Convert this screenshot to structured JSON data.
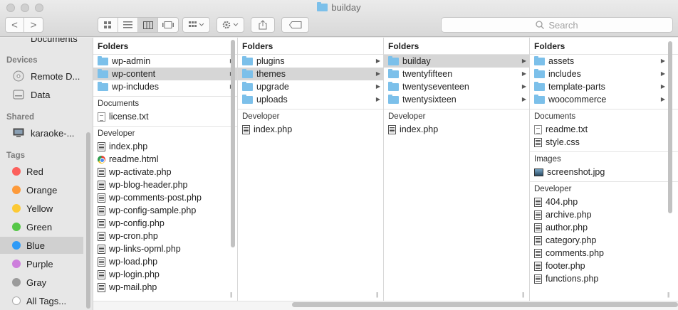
{
  "window": {
    "title": "builday"
  },
  "toolbar": {
    "back": "<",
    "forward": ">",
    "view_icons": [
      "icon-view",
      "list-view",
      "column-view",
      "gallery-view"
    ],
    "arrange": "arrange",
    "action": "action",
    "share": "share",
    "tags": "tags",
    "search_placeholder": "Search"
  },
  "sidebar": {
    "partial_top": "Documents",
    "devices_head": "Devices",
    "devices": [
      "Remote D...",
      "Data"
    ],
    "shared_head": "Shared",
    "shared": [
      "karaoke-..."
    ],
    "tags_head": "Tags",
    "tags": [
      {
        "label": "Red",
        "color": "#fc605c"
      },
      {
        "label": "Orange",
        "color": "#fd9a3a"
      },
      {
        "label": "Yellow",
        "color": "#fcc935"
      },
      {
        "label": "Green",
        "color": "#56c748"
      },
      {
        "label": "Blue",
        "color": "#2f9bf7"
      },
      {
        "label": "Purple",
        "color": "#cd7fdc"
      },
      {
        "label": "Gray",
        "color": "#9b9b9b"
      },
      {
        "label": "All Tags..."
      }
    ]
  },
  "col1": {
    "head": "Folders",
    "folders": [
      "wp-admin",
      "wp-content",
      "wp-includes"
    ],
    "docs_head": "Documents",
    "docs": [
      "license.txt"
    ],
    "dev_head": "Developer",
    "dev": [
      "index.php",
      "readme.html",
      "wp-activate.php",
      "wp-blog-header.php",
      "wp-comments-post.php",
      "wp-config-sample.php",
      "wp-config.php",
      "wp-cron.php",
      "wp-links-opml.php",
      "wp-load.php",
      "wp-login.php",
      "wp-mail.php"
    ]
  },
  "col2": {
    "head": "Folders",
    "folders": [
      "plugins",
      "themes",
      "upgrade",
      "uploads"
    ],
    "dev_head": "Developer",
    "dev": [
      "index.php"
    ]
  },
  "col3": {
    "head": "Folders",
    "folders": [
      "builday",
      "twentyfifteen",
      "twentyseventeen",
      "twentysixteen"
    ],
    "dev_head": "Developer",
    "dev": [
      "index.php"
    ]
  },
  "col4": {
    "head": "Folders",
    "folders": [
      "assets",
      "includes",
      "template-parts",
      "woocommerce"
    ],
    "docs_head": "Documents",
    "docs": [
      "readme.txt",
      "style.css"
    ],
    "img_head": "Images",
    "images": [
      "screenshot.jpg"
    ],
    "dev_head": "Developer",
    "dev": [
      "404.php",
      "archive.php",
      "author.php",
      "category.php",
      "comments.php",
      "footer.php",
      "functions.php"
    ]
  }
}
